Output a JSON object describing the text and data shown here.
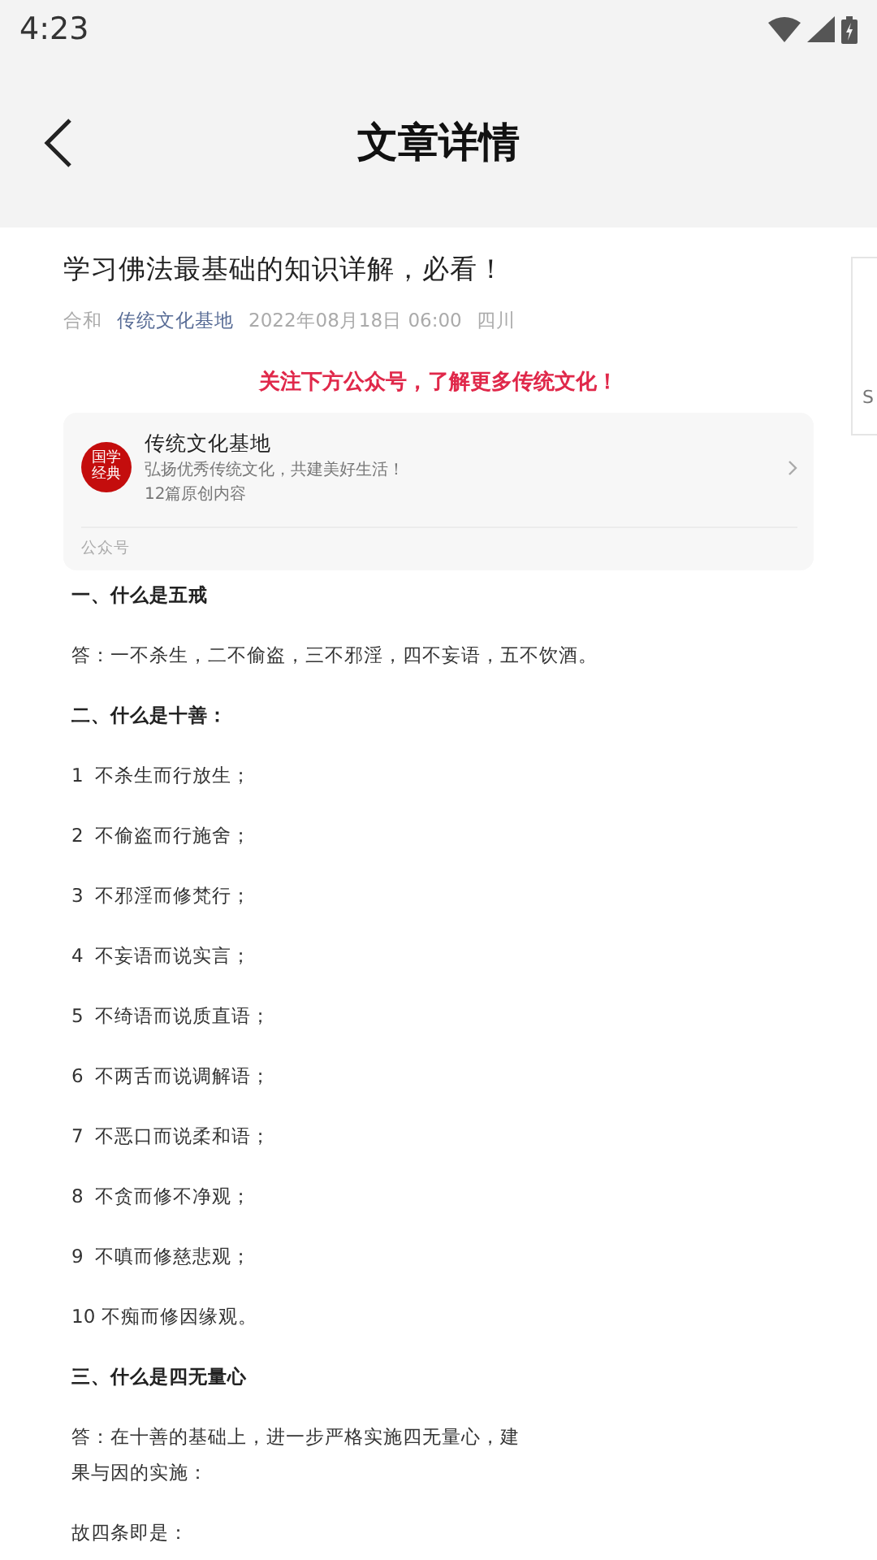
{
  "status_bar": {
    "time": "4:23"
  },
  "header": {
    "title": "文章详情"
  },
  "article": {
    "title": "学习佛法最基础的知识详解，必看！",
    "author": "合和",
    "account": "传统文化基地",
    "date": "2022年08月18日 06:00",
    "location": "四川"
  },
  "notice": "关注下方公众号，了解更多传统文化！",
  "account_card": {
    "logo": "国学经典",
    "name": "传统文化基地",
    "slogan": "弘扬优秀传统文化，共建美好生活！",
    "count": "12篇原创内容",
    "footer": "公众号"
  },
  "side_card": {
    "text": "S"
  },
  "body": [
    {
      "kind": "heading",
      "text": "一、什么是五戒"
    },
    {
      "kind": "para",
      "text": "答：一不杀生，二不偷盗，三不邪淫，四不妄语，五不饮酒。"
    },
    {
      "kind": "heading",
      "text": "二、什么是十善："
    },
    {
      "kind": "para",
      "text": "1  不杀生而行放生；"
    },
    {
      "kind": "para",
      "text": "2  不偷盗而行施舍；"
    },
    {
      "kind": "para",
      "text": "3  不邪淫而修梵行；"
    },
    {
      "kind": "para",
      "text": "4  不妄语而说实言；"
    },
    {
      "kind": "para",
      "text": "5  不绮语而说质直语；"
    },
    {
      "kind": "para",
      "text": "6  不两舌而说调解语；"
    },
    {
      "kind": "para",
      "text": "7  不恶口而说柔和语；"
    },
    {
      "kind": "para",
      "text": "8  不贪而修不净观；"
    },
    {
      "kind": "para",
      "text": "9  不嗔而修慈悲观；"
    },
    {
      "kind": "para",
      "text": "10 不痴而修因缘观。"
    },
    {
      "kind": "heading",
      "text": "三、什么是四无量心"
    },
    {
      "kind": "para",
      "lines": [
        "答：在十善的基础上，进一步严格实施四无量心，建",
        "果与因的实施："
      ]
    },
    {
      "kind": "para",
      "text": "故四条即是："
    }
  ]
}
